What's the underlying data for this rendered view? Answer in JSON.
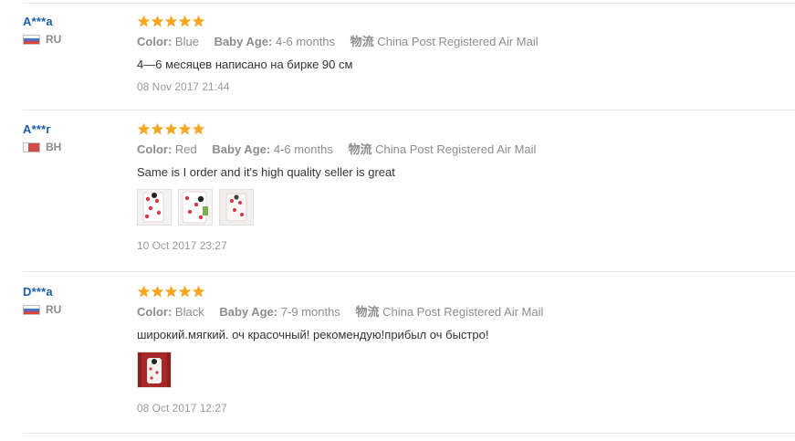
{
  "reviews": [
    {
      "user": "A***a",
      "country": "RU",
      "rating": 5,
      "color_label": "Color:",
      "color": "Blue",
      "age_label": "Baby Age:",
      "age": "4-6 months",
      "ship_label": "物流",
      "shipping": "China Post Registered Air Mail",
      "text": "4—6 месяцев написано на бирке 90 см",
      "date": "08 Nov 2017 21:44"
    },
    {
      "user": "A***г",
      "country": "BH",
      "rating": 5,
      "color_label": "Color:",
      "color": "Red",
      "age_label": "Baby Age:",
      "age": "4-6 months",
      "ship_label": "物流",
      "shipping": "China Post Registered Air Mail",
      "text": "Same is I order and it's high quality seller is great",
      "date": "10 Oct 2017 23:27"
    },
    {
      "user": "D***a",
      "country": "RU",
      "rating": 5,
      "color_label": "Color:",
      "color": "Black",
      "age_label": "Baby Age:",
      "age": "7-9 months",
      "ship_label": "物流",
      "shipping": "China Post Registered Air Mail",
      "text": "широкий.мягкий. оч красочный! рекомендую!прибыл оч быстро!",
      "date": "08 Oct 2017 12:27"
    }
  ],
  "colors": {
    "star": "#f5a623",
    "username": "#1a5fa8",
    "muted": "#8c8c8c",
    "divider": "#e8e8e8"
  },
  "icons": {
    "star": "star-icon",
    "flag": "flag-icon",
    "photo": "review-photo"
  }
}
